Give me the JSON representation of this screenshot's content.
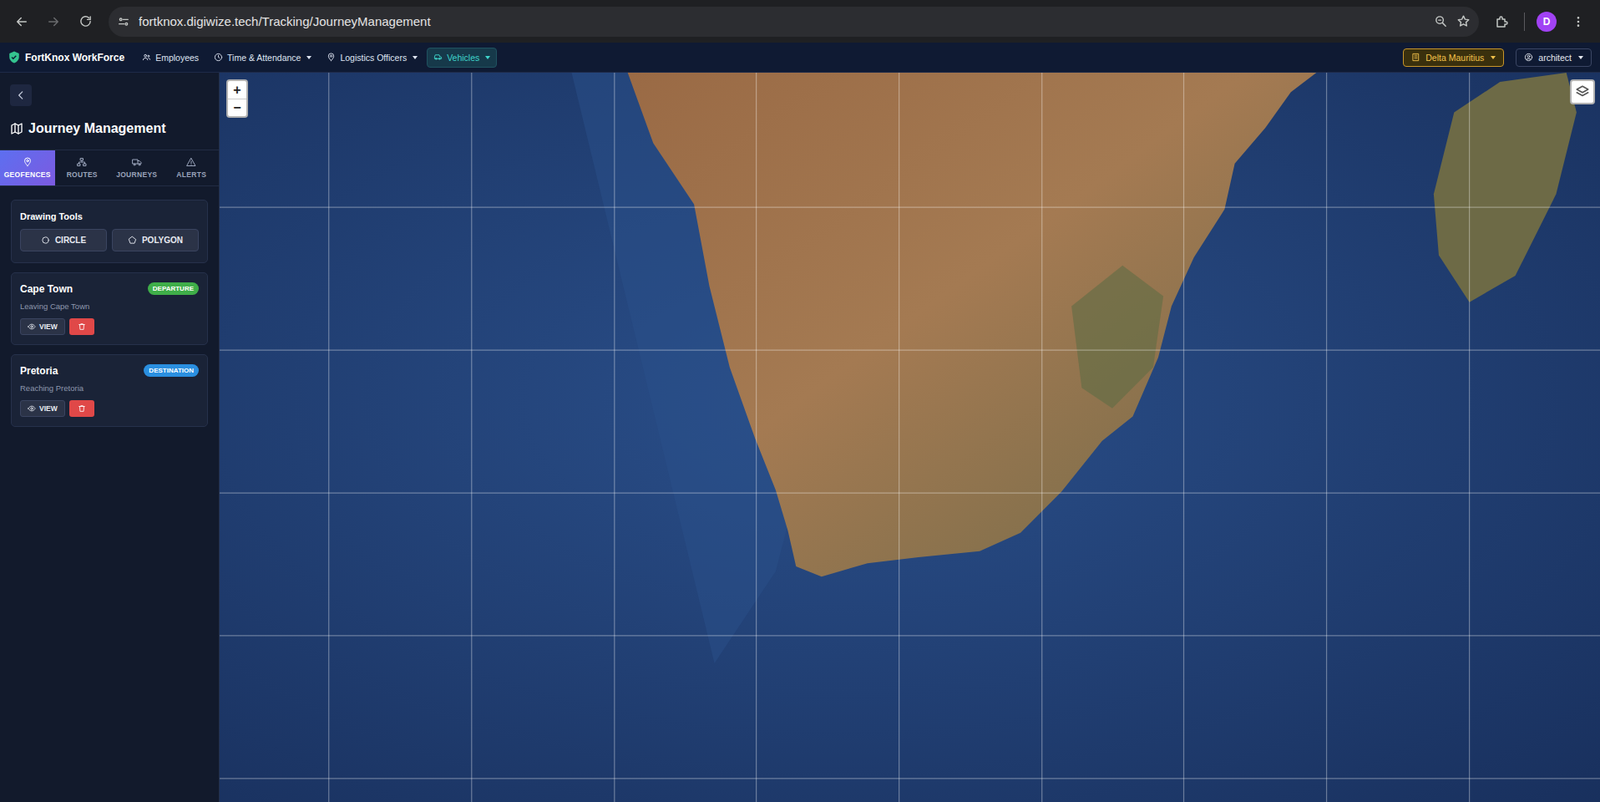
{
  "browser": {
    "url": "fortknox.digiwize.tech/Tracking/JourneyManagement",
    "profile_initial": "D"
  },
  "nav": {
    "brand": "FortKnox WorkForce",
    "items": [
      {
        "label": "Employees",
        "dropdown": false,
        "selected": false
      },
      {
        "label": "Time & Attendance",
        "dropdown": true,
        "selected": false
      },
      {
        "label": "Logistics Officers",
        "dropdown": true,
        "selected": false
      },
      {
        "label": "Vehicles",
        "dropdown": true,
        "selected": true
      }
    ],
    "company": "Delta Mauritius",
    "user": "architect"
  },
  "sidebar": {
    "title": "Journey Management",
    "tabs": [
      {
        "label": "GEOFENCES",
        "selected": true
      },
      {
        "label": "ROUTES",
        "selected": false
      },
      {
        "label": "JOURNEYS",
        "selected": false
      },
      {
        "label": "ALERTS",
        "selected": false
      }
    ],
    "drawing_tools": {
      "title": "Drawing Tools",
      "buttons": [
        "CIRCLE",
        "POLYGON"
      ]
    },
    "geofences": [
      {
        "name": "Cape Town",
        "type": "DEPARTURE",
        "color": "#3fae49",
        "description": "Leaving Cape Town",
        "view_label": "VIEW"
      },
      {
        "name": "Pretoria",
        "type": "DESTINATION",
        "color": "#2a8fe0",
        "description": "Reaching Pretoria",
        "view_label": "VIEW"
      }
    ]
  },
  "map": {
    "zoom_in": "+",
    "zoom_out": "−"
  }
}
